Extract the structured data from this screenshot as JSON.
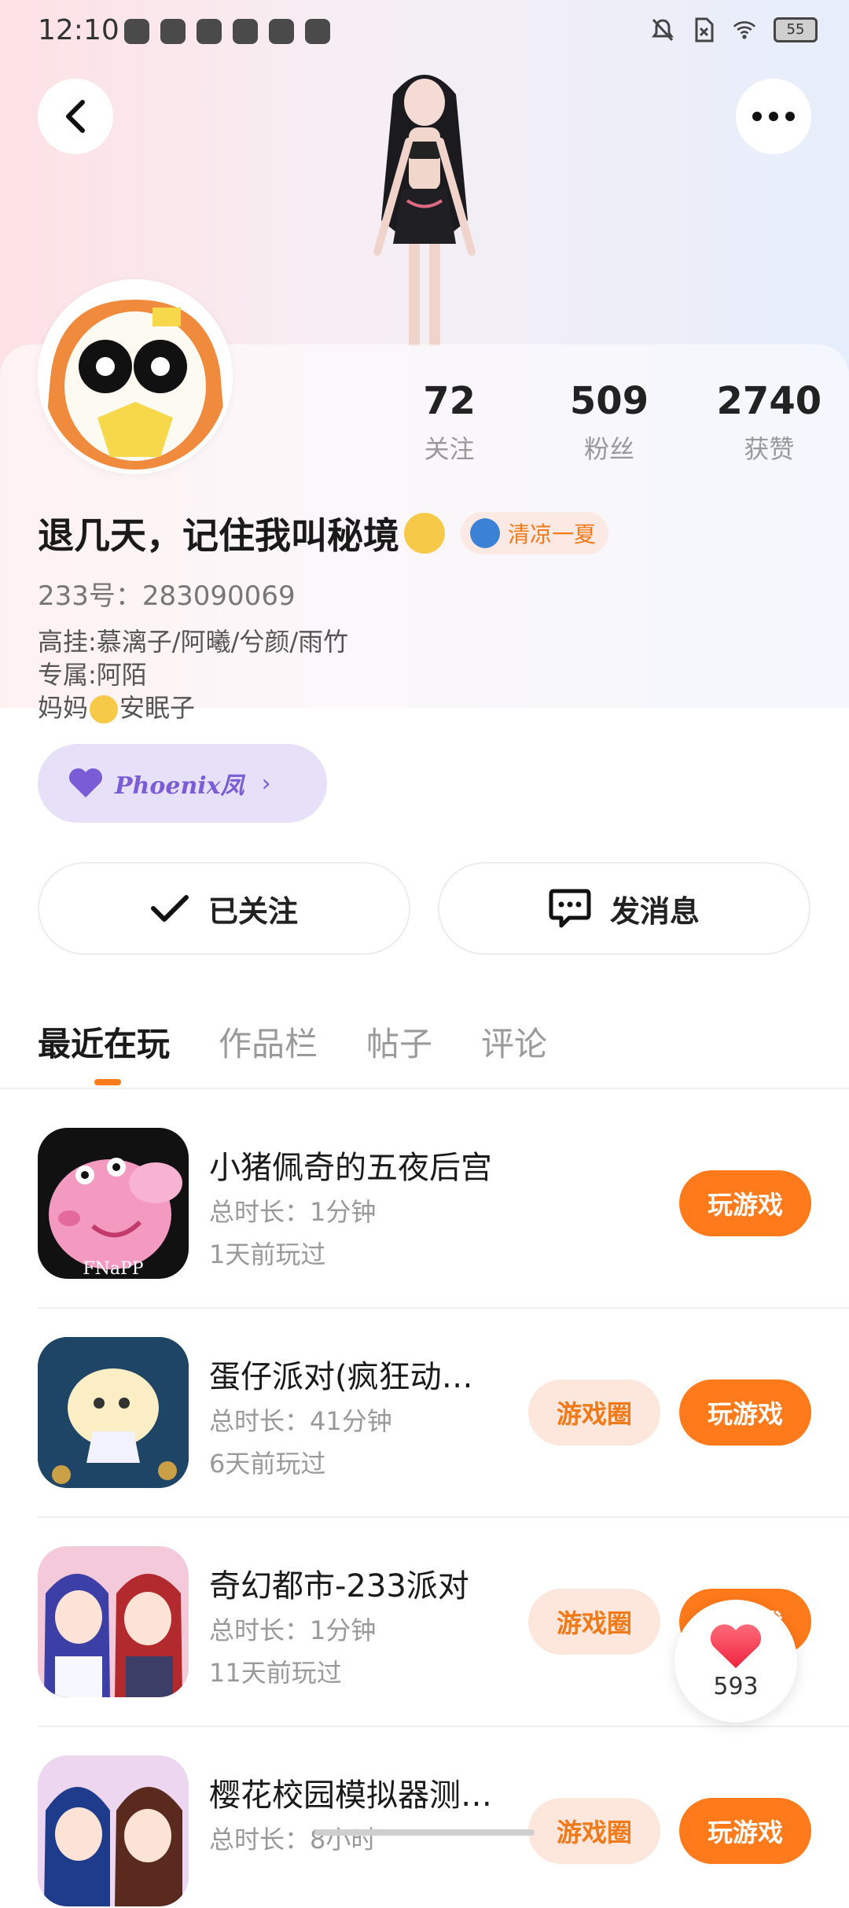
{
  "status_bar": {
    "time": "12:10",
    "battery": "55"
  },
  "profile": {
    "stats": [
      {
        "value": "72",
        "label": "关注"
      },
      {
        "value": "509",
        "label": "粉丝"
      },
      {
        "value": "2740",
        "label": "获赞"
      }
    ],
    "nickname": "退几天，记住我叫秘境",
    "badge_label": "清凉一夏",
    "uid_line": "233号：283090069",
    "bio_lines": [
      "高挂:慕漓子/阿曦/兮颜/雨竹",
      "专属:阿陌",
      "妈妈",
      "安眠子"
    ],
    "phoenix_label": "Phoenix凤",
    "follow_label": "已关注",
    "message_label": "发消息"
  },
  "tabs": [
    {
      "label": "最近在玩",
      "active": true
    },
    {
      "label": "作品栏",
      "active": false
    },
    {
      "label": "帖子",
      "active": false
    },
    {
      "label": "评论",
      "active": false
    }
  ],
  "games": [
    {
      "title": "小猪佩奇的五夜后宫",
      "duration": "总时长：1分钟",
      "last_played": "1天前玩过",
      "circle": "",
      "play": "玩游戏",
      "icon_text": "FNaPP"
    },
    {
      "title": "蛋仔派对(疯狂动…",
      "duration": "总时长：41分钟",
      "last_played": "6天前玩过",
      "circle": "游戏圈",
      "play": "玩游戏"
    },
    {
      "title": "奇幻都市-233派对",
      "duration": "总时长：1分钟",
      "last_played": "11天前玩过",
      "circle": "游戏圈",
      "play": "玩游戏"
    },
    {
      "title": "樱花校园模拟器测…",
      "duration": "总时长：8小时",
      "last_played": "",
      "circle": "游戏圈",
      "play": "玩游戏"
    }
  ],
  "like_fab": {
    "count": "593"
  },
  "colors": {
    "accent": "#ff7a1a",
    "accent_soft": "#fde6dc",
    "phoenix": "#7a5cd6"
  }
}
